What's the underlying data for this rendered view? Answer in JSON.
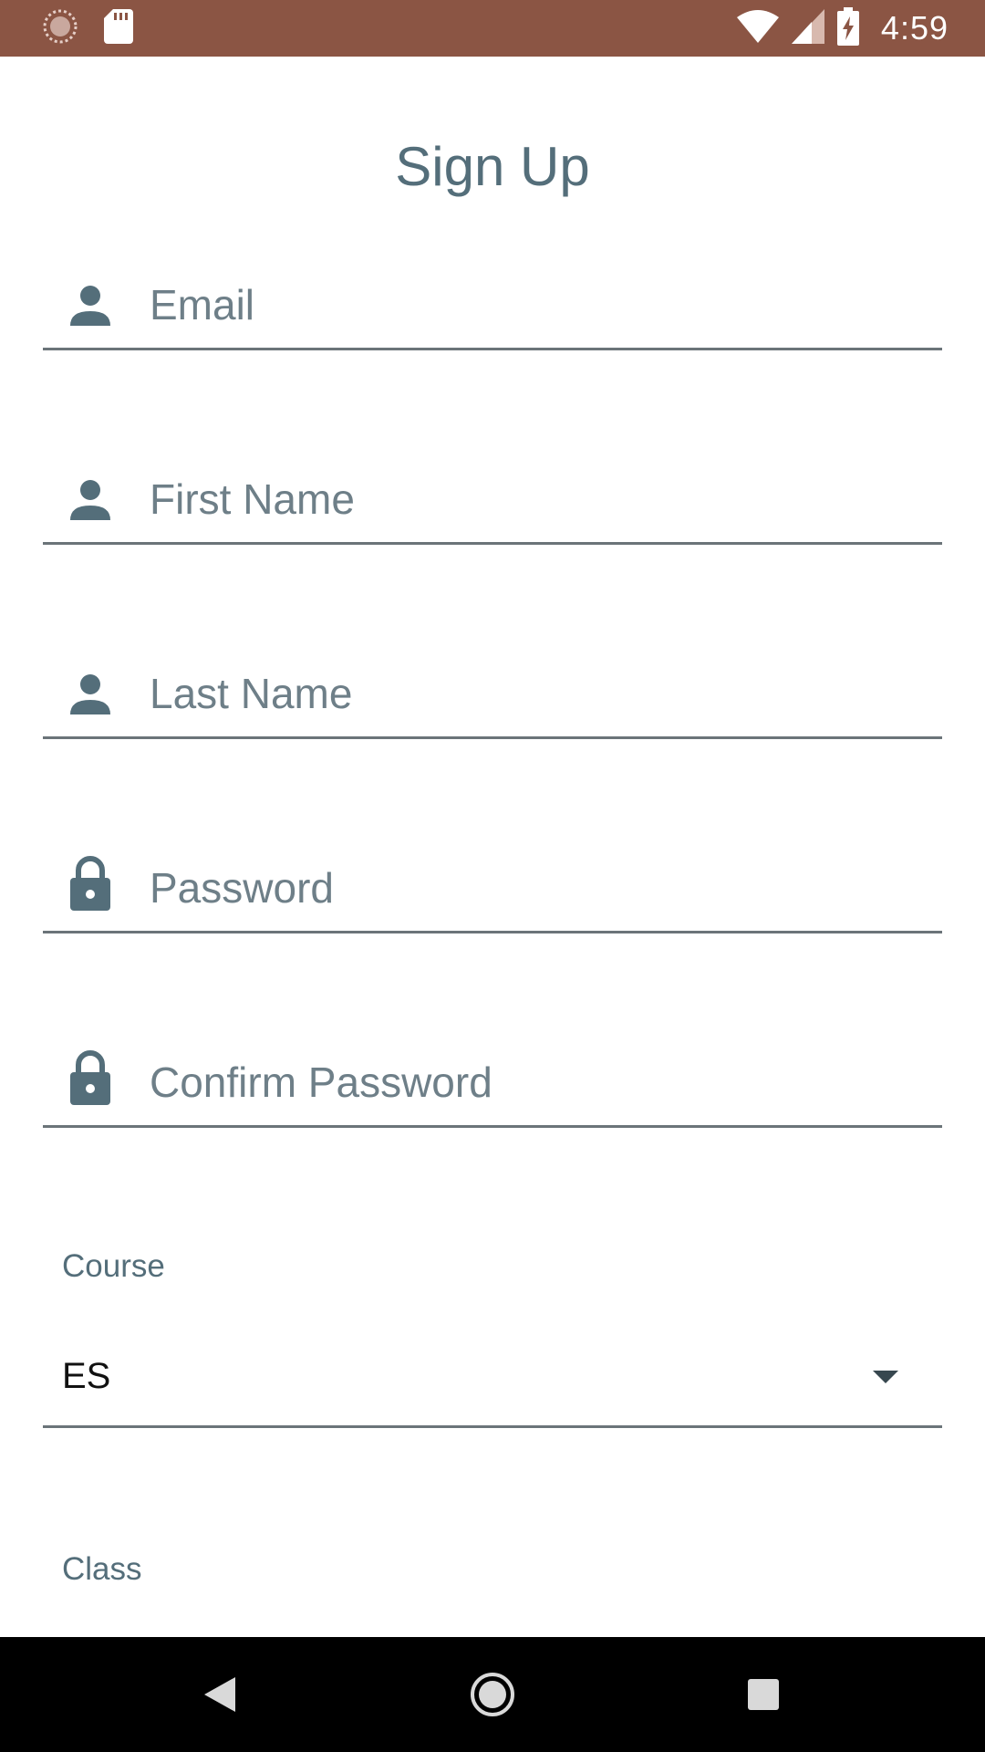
{
  "status_bar": {
    "time": "4:59",
    "icons": [
      "loading-icon",
      "sd-card-icon",
      "wifi-icon",
      "cell-signal-icon",
      "battery-charging-icon"
    ],
    "background": "#8b5544"
  },
  "page": {
    "title": "Sign Up"
  },
  "form": {
    "email": {
      "placeholder": "Email",
      "value": "",
      "icon": "person-icon"
    },
    "first_name": {
      "placeholder": "First Name",
      "value": "",
      "icon": "person-icon"
    },
    "last_name": {
      "placeholder": "Last Name",
      "value": "",
      "icon": "person-icon"
    },
    "password": {
      "placeholder": "Password",
      "value": "",
      "icon": "lock-icon"
    },
    "confirm_password": {
      "placeholder": "Confirm Password",
      "value": "",
      "icon": "lock-icon"
    },
    "course": {
      "label": "Course",
      "selected": "ES"
    },
    "class": {
      "label": "Class"
    }
  },
  "nav_bar": {
    "buttons": [
      "back-icon",
      "home-icon",
      "recents-icon"
    ]
  },
  "colors": {
    "accent": "#546e7a",
    "underline": "#6b7479",
    "status_bar": "#8b5544"
  }
}
